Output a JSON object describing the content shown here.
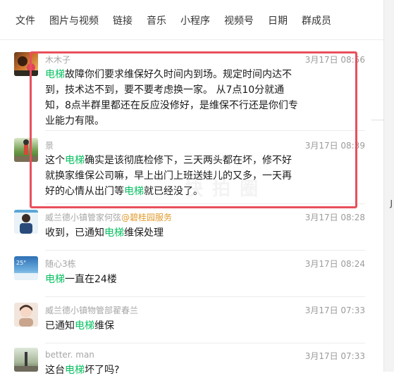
{
  "tabs": [
    "文件",
    "图片与视频",
    "链接",
    "音乐",
    "小程序",
    "视频号",
    "日期",
    "群成员"
  ],
  "keyword_color": "#07c160",
  "highlight_color": "#e8505b",
  "watermark": "快 拍 圈",
  "side_glyph": "J",
  "messages": [
    {
      "sender": "木木子",
      "time": "3月17日 08:56",
      "lines": [
        [
          "",
          "电梯",
          "故障你们要求维保好久时间内到场。规定时间内达不"
        ],
        [
          "到，技术达不到，要不要考虑换一家。 从7点10分就通",
          "",
          ""
        ],
        [
          "知，8点半群里都还在反应没修好，是维保不行还是你们专",
          "",
          ""
        ],
        [
          "业能力有限。",
          "",
          ""
        ]
      ]
    },
    {
      "sender": "景",
      "time": "3月17日 08:39",
      "lines": [
        [
          "这个",
          "电梯",
          "确实是该彻底检修下，三天两头都在坏，修不好"
        ],
        [
          "就换家维保公司嘛，早上出门上班送娃儿的又多，一天再",
          "",
          ""
        ],
        [
          "好的心情从出门等",
          "电梯",
          "就已经没了。"
        ]
      ]
    },
    {
      "sender": "威兰德小镇管家何弦",
      "sender_tag": "@碧桂园服务",
      "time": "3月17日 08:28",
      "lines": [
        [
          "收到，已通知",
          "电梯",
          "维保处理"
        ]
      ]
    },
    {
      "sender": "随心3栋",
      "time": "3月17日 08:24",
      "lines": [
        [
          "",
          "电梯",
          "一直在24楼"
        ]
      ]
    },
    {
      "sender": "威兰德小镇物管部翟春兰",
      "time": "3月17日 07:33",
      "lines": [
        [
          "已通知",
          "电梯",
          "维保"
        ]
      ]
    },
    {
      "sender": "better. man",
      "time": "3月17日 07:33",
      "lines": [
        [
          "这台",
          "电梯",
          "坏了吗?"
        ]
      ]
    }
  ]
}
